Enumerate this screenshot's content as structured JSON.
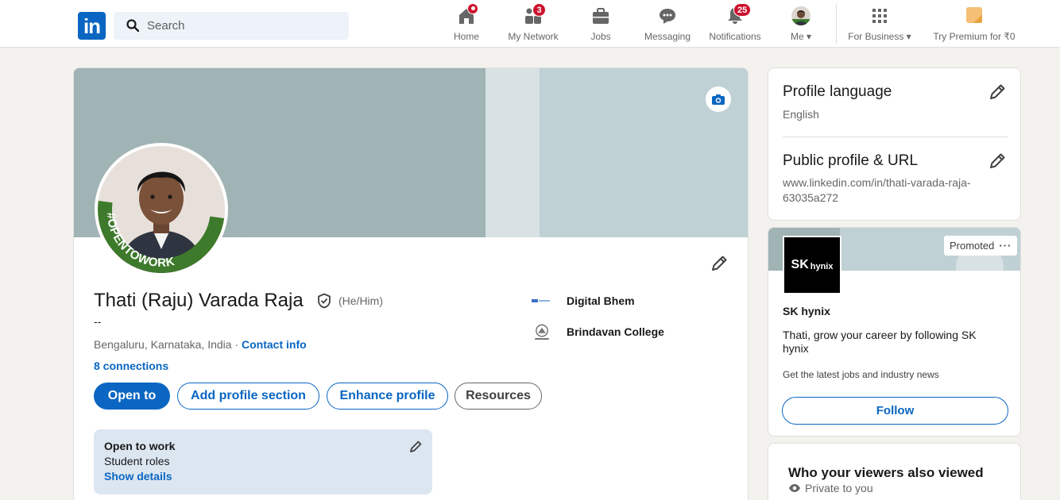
{
  "nav": {
    "logo": "in",
    "search_placeholder": "Search",
    "items": [
      {
        "label": "Home",
        "badge": null
      },
      {
        "label": "My Network",
        "badge": "3"
      },
      {
        "label": "Jobs",
        "badge": null
      },
      {
        "label": "Messaging",
        "badge": null
      },
      {
        "label": "Notifications",
        "badge": "25"
      },
      {
        "label": "Me",
        "badge": null
      },
      {
        "label": "For Business",
        "badge": null
      },
      {
        "label": "Try Premium for ₹0",
        "badge": null
      }
    ]
  },
  "profile": {
    "name": "Thati (Raju) Varada Raja",
    "pronouns": "(He/Him)",
    "headline": "--",
    "location": "Bengaluru, Karnataka, India · ",
    "contact_info": "Contact info",
    "connections": "8 connections",
    "avatar_frame_text": "#OPENTOWORK",
    "buttons": {
      "open_to": "Open to",
      "add_section": "Add profile section",
      "enhance": "Enhance profile",
      "resources": "Resources"
    },
    "experience": [
      {
        "name": "Digital Bhem"
      },
      {
        "name": "Brindavan College"
      }
    ],
    "open_to_work": {
      "title": "Open to work",
      "roles": "Student roles",
      "link": "Show details"
    }
  },
  "sidebar": {
    "profile_language": {
      "title": "Profile language",
      "value": "English"
    },
    "public_profile": {
      "title": "Public profile & URL",
      "value": "www.linkedin.com/in/thati-varada-raja-63035a272"
    },
    "ad": {
      "promoted": "Promoted",
      "logo_text": "SK",
      "logo_small": "hynix",
      "company": "SK hynix",
      "text": "Thati, grow your career by following SK hynix",
      "small": "Get the latest jobs and industry news",
      "follow": "Follow"
    },
    "viewers": {
      "title": "Who your viewers also viewed",
      "sub": "Private to you"
    }
  },
  "colors": {
    "brand": "#0a66c2",
    "badge": "#cb112d",
    "otw_green": "#3d7a2b"
  }
}
